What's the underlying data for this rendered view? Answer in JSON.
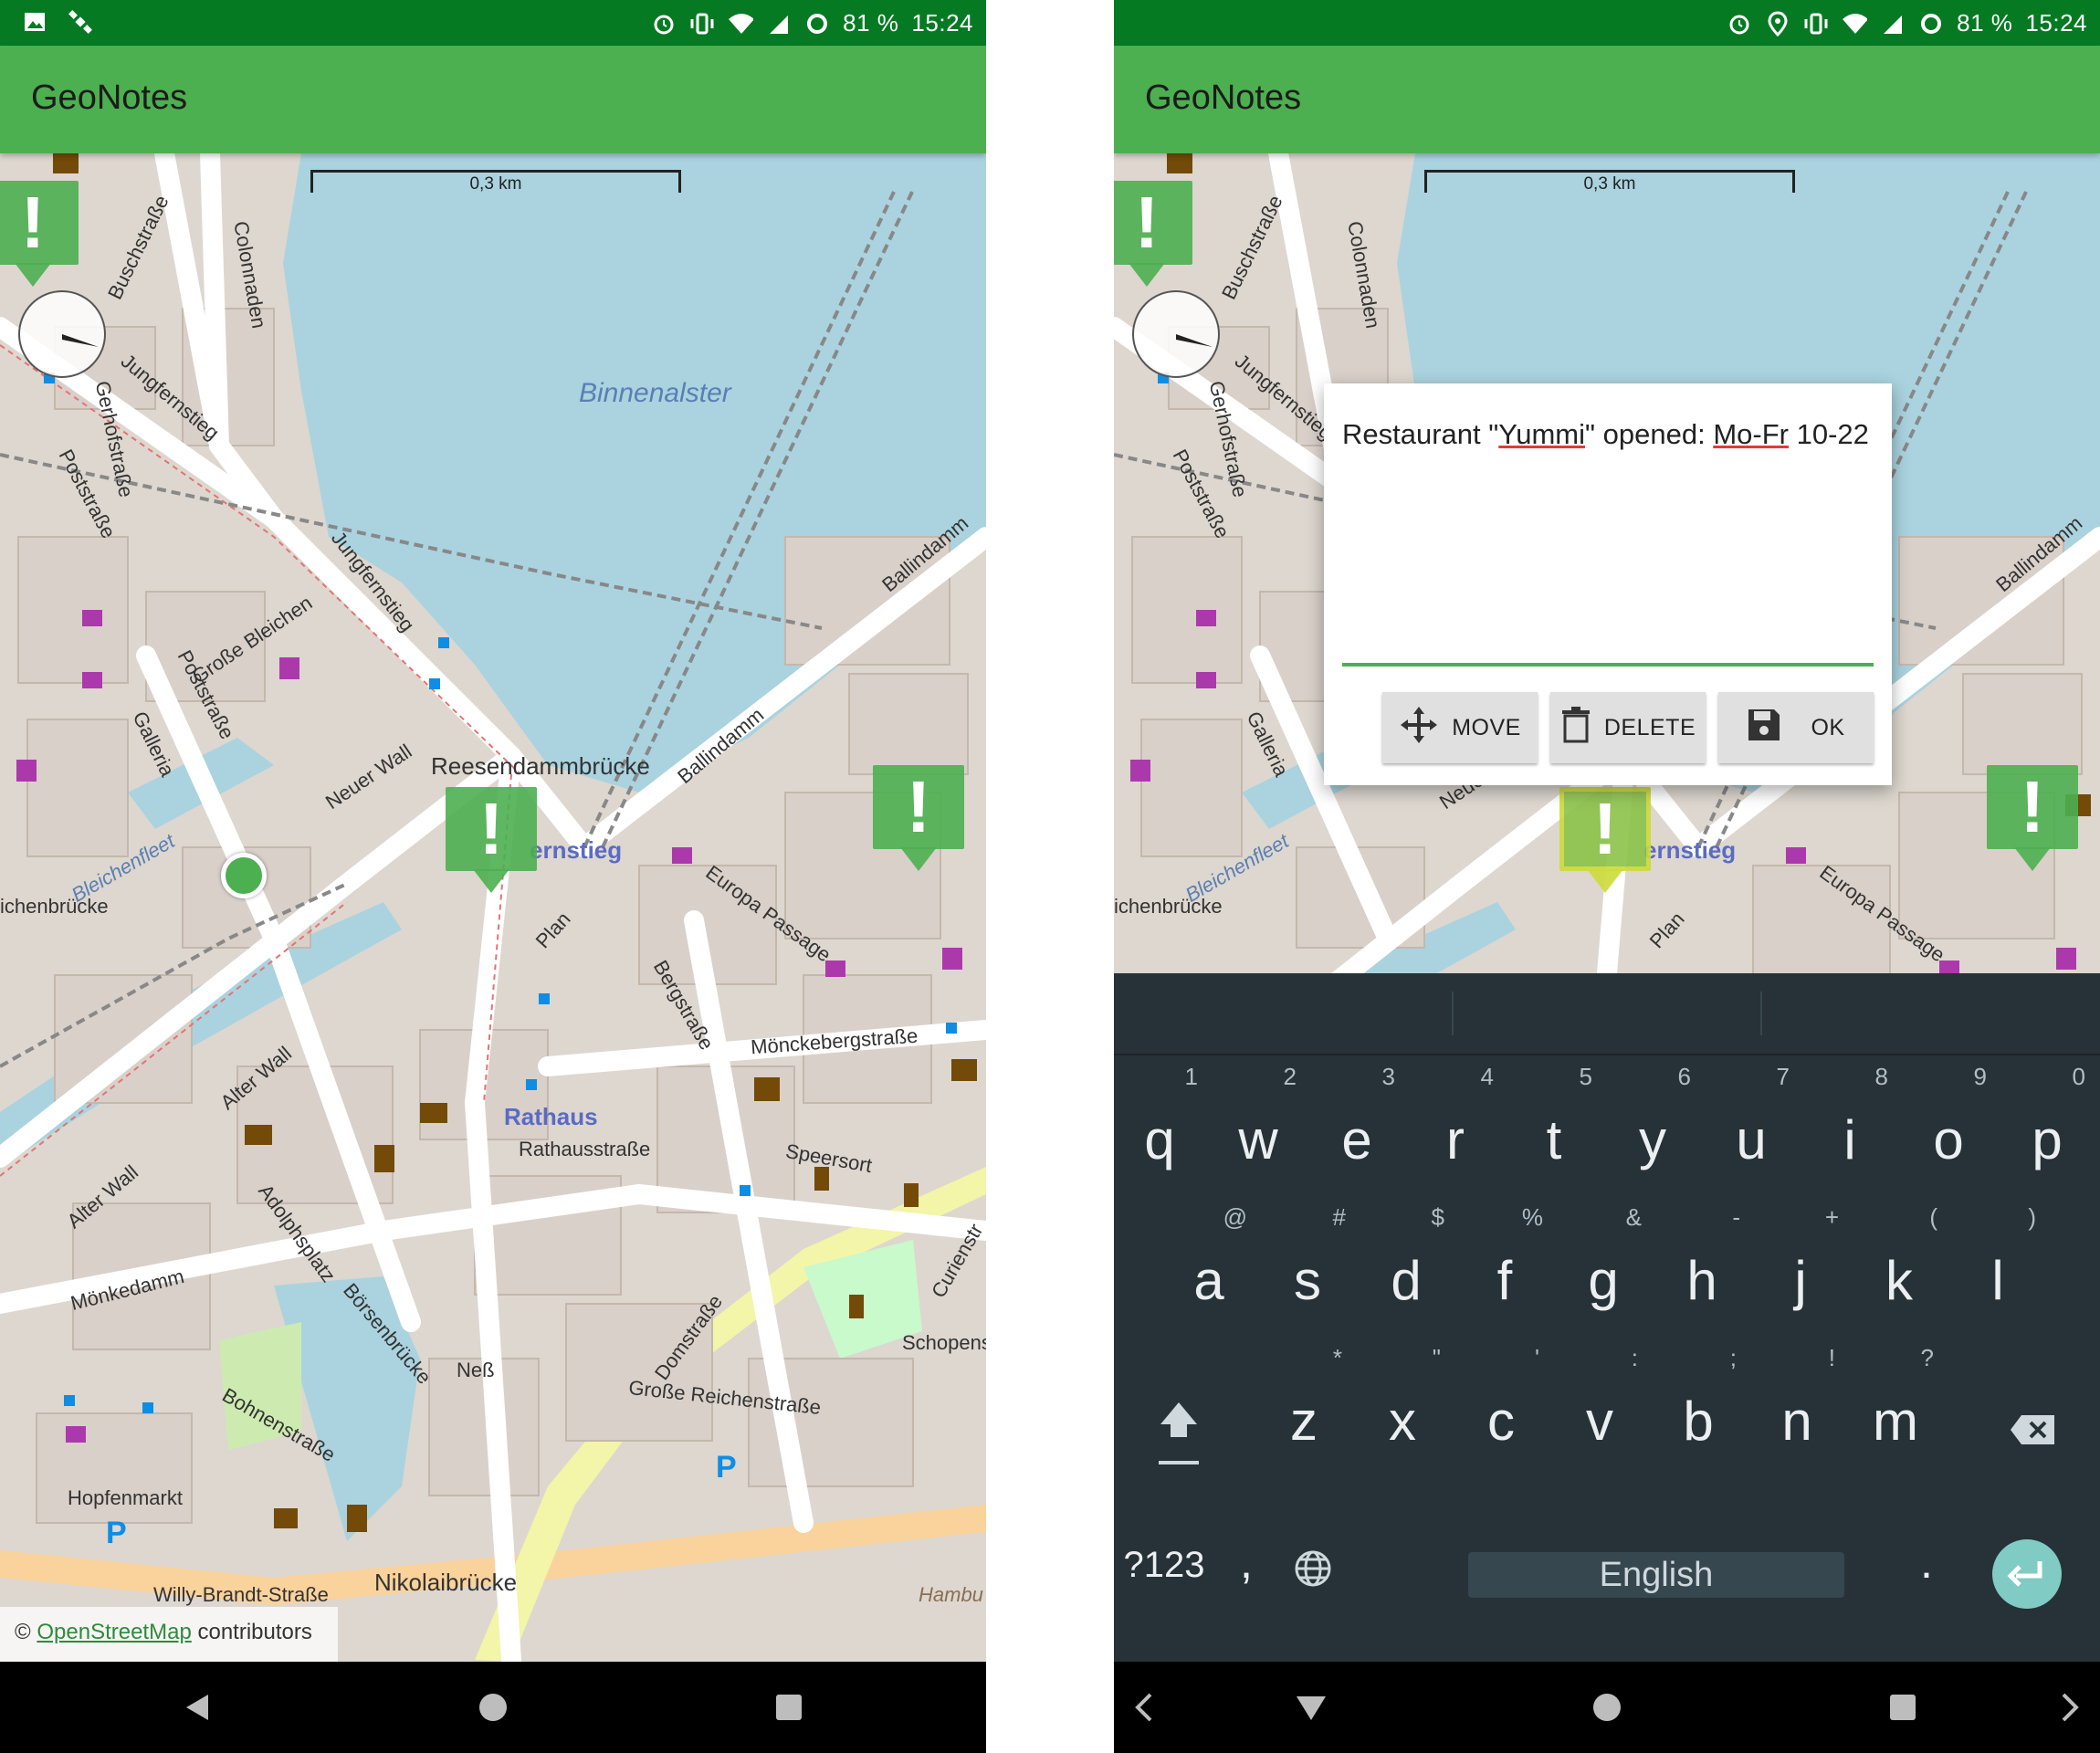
{
  "status_bar": {
    "battery": "81 %",
    "time": "15:24",
    "icons_left": [
      "image-icon",
      "satellite-icon"
    ],
    "icons_right_left_phone": [
      "alarm-icon",
      "vibrate-icon",
      "wifi-icon",
      "signal-icon",
      "battery-ring-icon"
    ],
    "icons_right_right_phone": [
      "alarm-icon",
      "location-icon",
      "vibrate-icon",
      "wifi-icon",
      "signal-icon",
      "battery-ring-icon"
    ]
  },
  "app_bar": {
    "title": "GeoNotes",
    "color": "#4caf50",
    "status_color": "#067a23"
  },
  "map": {
    "scale": "0,3 km",
    "lake_label": "Binnenalster",
    "labels": {
      "reesendammbruecke": "Reesendammbrücke",
      "jungfernstieg_stop": "ernstieg",
      "rathaus": "Rathaus",
      "rathausstrasse": "Rathausstraße",
      "moenckeberg": "Mönckebergstraße",
      "europa_passage": "Europa Passage",
      "ballindamm": "Ballindamm",
      "bergstrasse": "Bergstraße",
      "neuer_wall": "Neuer Wall",
      "alter_wall": "Alter Wall",
      "grosse_bleichen": "Große Bleichen",
      "poststrasse": "Poststraße",
      "colonnaden": "Colonnaden",
      "buschstrasse": "Buschstraße",
      "jungfernstieg": "Jungfernstieg",
      "gerhofstrasse": "Gerhofstraße",
      "plan": "Plan",
      "speersort": "Speersort",
      "domstrasse": "Domstraße",
      "grosse_reichenstrasse": "Große Reichenstraße",
      "nikolaibruecke": "Nikolaibrücke",
      "willy_brandt": "Willy-Brandt-Straße",
      "hopfenmarkt": "Hopfenmarkt",
      "moenkedamm": "Mönkedamm",
      "bleichenfleet": "Bleichenfleet",
      "ichenbruecke": "ichenbrücke",
      "schopens": "Schopens",
      "curienstr": "Curienstr",
      "ness": "Neß",
      "boersenbruecke": "Börsenbrücke",
      "bohnenstrasse": "Bohnenstraße",
      "adolphsplatz": "Adolphsplatz",
      "galleria": "Galleria",
      "hamburg_heights": "Hambu Heigh",
      "parking": "P"
    },
    "attribution_prefix": "© ",
    "attribution_link": "OpenStreetMap",
    "attribution_suffix": " contributors"
  },
  "dialog": {
    "note_part1": "Restaurant \"",
    "note_word1": "Yummi",
    "note_part2": "\" opened: ",
    "note_word2": "Mo-Fr",
    "note_part3": " 10-22",
    "buttons": {
      "move": "MOVE",
      "delete": "DELETE",
      "ok": "OK"
    }
  },
  "keyboard": {
    "row1": [
      {
        "k": "q",
        "h": "1"
      },
      {
        "k": "w",
        "h": "2"
      },
      {
        "k": "e",
        "h": "3"
      },
      {
        "k": "r",
        "h": "4"
      },
      {
        "k": "t",
        "h": "5"
      },
      {
        "k": "y",
        "h": "6"
      },
      {
        "k": "u",
        "h": "7"
      },
      {
        "k": "i",
        "h": "8"
      },
      {
        "k": "o",
        "h": "9"
      },
      {
        "k": "p",
        "h": "0"
      }
    ],
    "row2": [
      {
        "k": "a",
        "h": "@"
      },
      {
        "k": "s",
        "h": "#"
      },
      {
        "k": "d",
        "h": "$"
      },
      {
        "k": "f",
        "h": "%"
      },
      {
        "k": "g",
        "h": "&"
      },
      {
        "k": "h",
        "h": "-"
      },
      {
        "k": "j",
        "h": "+"
      },
      {
        "k": "k",
        "h": "("
      },
      {
        "k": "l",
        "h": ")"
      }
    ],
    "row3": [
      {
        "k": "z",
        "h": "*"
      },
      {
        "k": "x",
        "h": "\""
      },
      {
        "k": "c",
        "h": "'"
      },
      {
        "k": "v",
        "h": ":"
      },
      {
        "k": "b",
        "h": ";"
      },
      {
        "k": "n",
        "h": "!"
      },
      {
        "k": "m",
        "h": "?"
      }
    ],
    "symbols": "?123",
    "comma": ",",
    "space": "English",
    "period": ".",
    "theme_color": "#263238",
    "enter_color": "#80cbc4"
  }
}
